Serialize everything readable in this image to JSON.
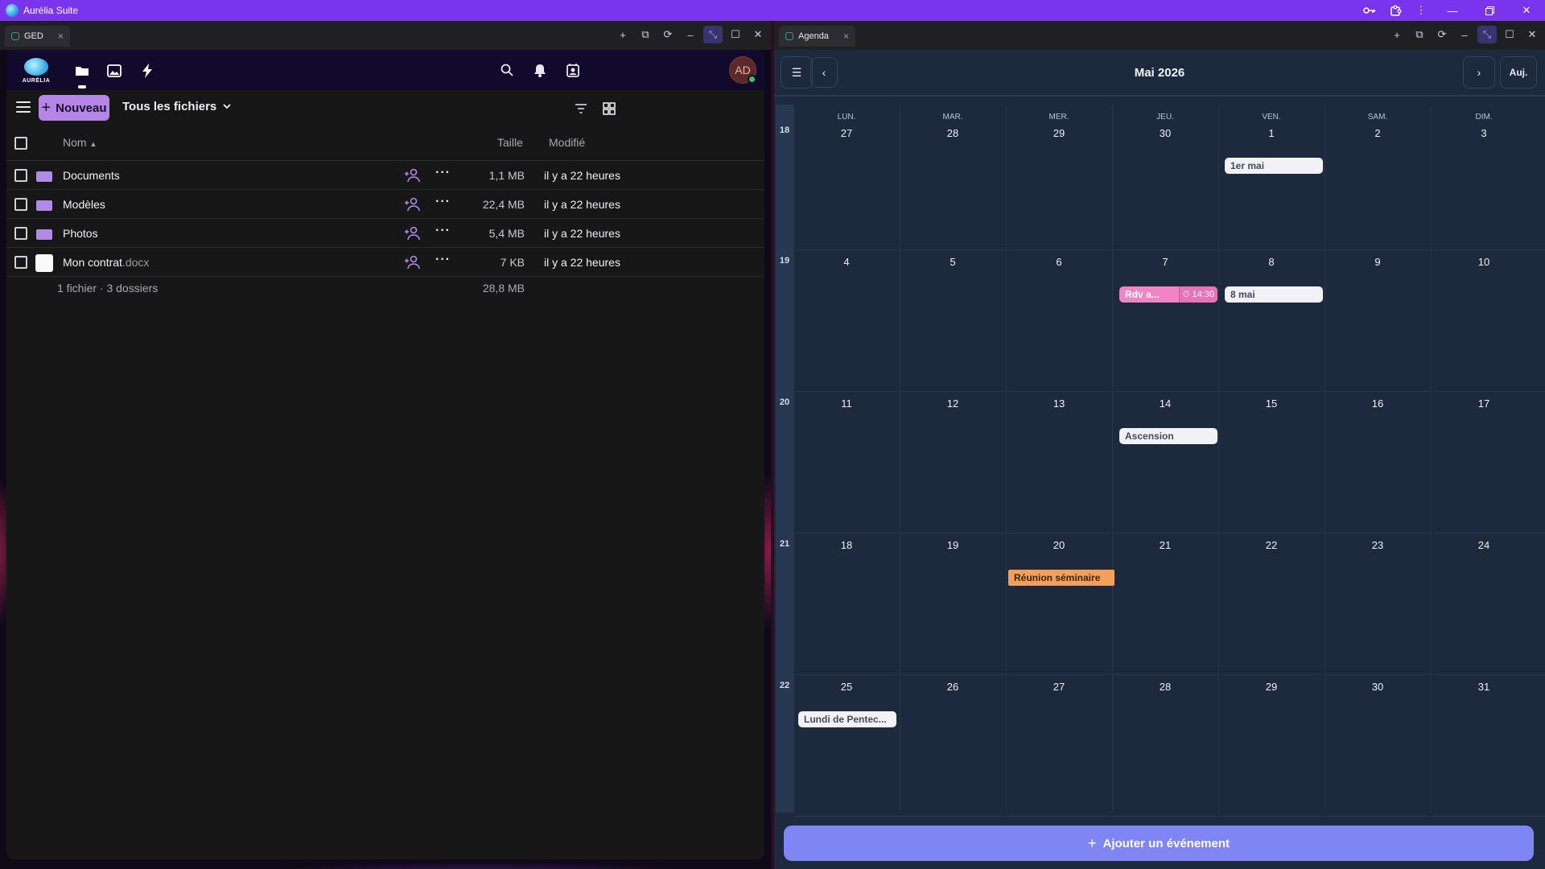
{
  "app": {
    "title": "Aurélia Suite"
  },
  "colors": {
    "titlebar": "#7b34ee",
    "accent": "#b686e6",
    "calendar_bg": "#1d2a3e",
    "add_button": "#7f86f3",
    "event_pink": "#f084c4",
    "event_orange": "#f4a05a"
  },
  "ged": {
    "tab_label": "GED",
    "logo_text": "AURÉLIA",
    "avatar": "AD",
    "new_button": "Nouveau",
    "filter_label": "Tous les fichiers",
    "columns": {
      "name": "Nom",
      "size": "Taille",
      "modified": "Modifié"
    },
    "files": [
      {
        "name": "Documents",
        "ext": "",
        "kind": "folder",
        "size": "1,1 MB",
        "modified": "il y a 22 heures"
      },
      {
        "name": "Modèles",
        "ext": "",
        "kind": "folder",
        "size": "22,4 MB",
        "modified": "il y a 22 heures"
      },
      {
        "name": "Photos",
        "ext": "",
        "kind": "folder",
        "size": "5,4 MB",
        "modified": "il y a 22 heures"
      },
      {
        "name": "Mon contrat",
        "ext": ".docx",
        "kind": "file",
        "size": "7 KB",
        "modified": "il y a 22 heures"
      }
    ],
    "summary": {
      "text": "1 fichier · 3 dossiers",
      "total": "28,8 MB"
    }
  },
  "agenda": {
    "tab_label": "Agenda",
    "month_title": "Mai 2026",
    "today_button": "Auj.",
    "weekdays": [
      "LUN.",
      "MAR.",
      "MER.",
      "JEU.",
      "VEN.",
      "SAM.",
      "DIM."
    ],
    "weeks": [
      {
        "number": "18",
        "days": [
          "27",
          "28",
          "29",
          "30",
          "1",
          "2",
          "3"
        ]
      },
      {
        "number": "19",
        "days": [
          "4",
          "5",
          "6",
          "7",
          "8",
          "9",
          "10"
        ]
      },
      {
        "number": "20",
        "days": [
          "11",
          "12",
          "13",
          "14",
          "15",
          "16",
          "17"
        ]
      },
      {
        "number": "21",
        "days": [
          "18",
          "19",
          "20",
          "21",
          "22",
          "23",
          "24"
        ]
      },
      {
        "number": "22",
        "days": [
          "25",
          "26",
          "27",
          "28",
          "29",
          "30",
          "31"
        ]
      }
    ],
    "events": [
      {
        "label": "1er mai",
        "style": "white"
      },
      {
        "label": "Rdv a...",
        "time": "14:30",
        "style": "pink"
      },
      {
        "label": "8 mai",
        "style": "white"
      },
      {
        "label": "Ascension",
        "style": "white"
      },
      {
        "label": "Réunion séminaire",
        "style": "orange"
      },
      {
        "label": "Lundi de Pentec...",
        "style": "white"
      }
    ],
    "add_button": "Ajouter un événement"
  }
}
